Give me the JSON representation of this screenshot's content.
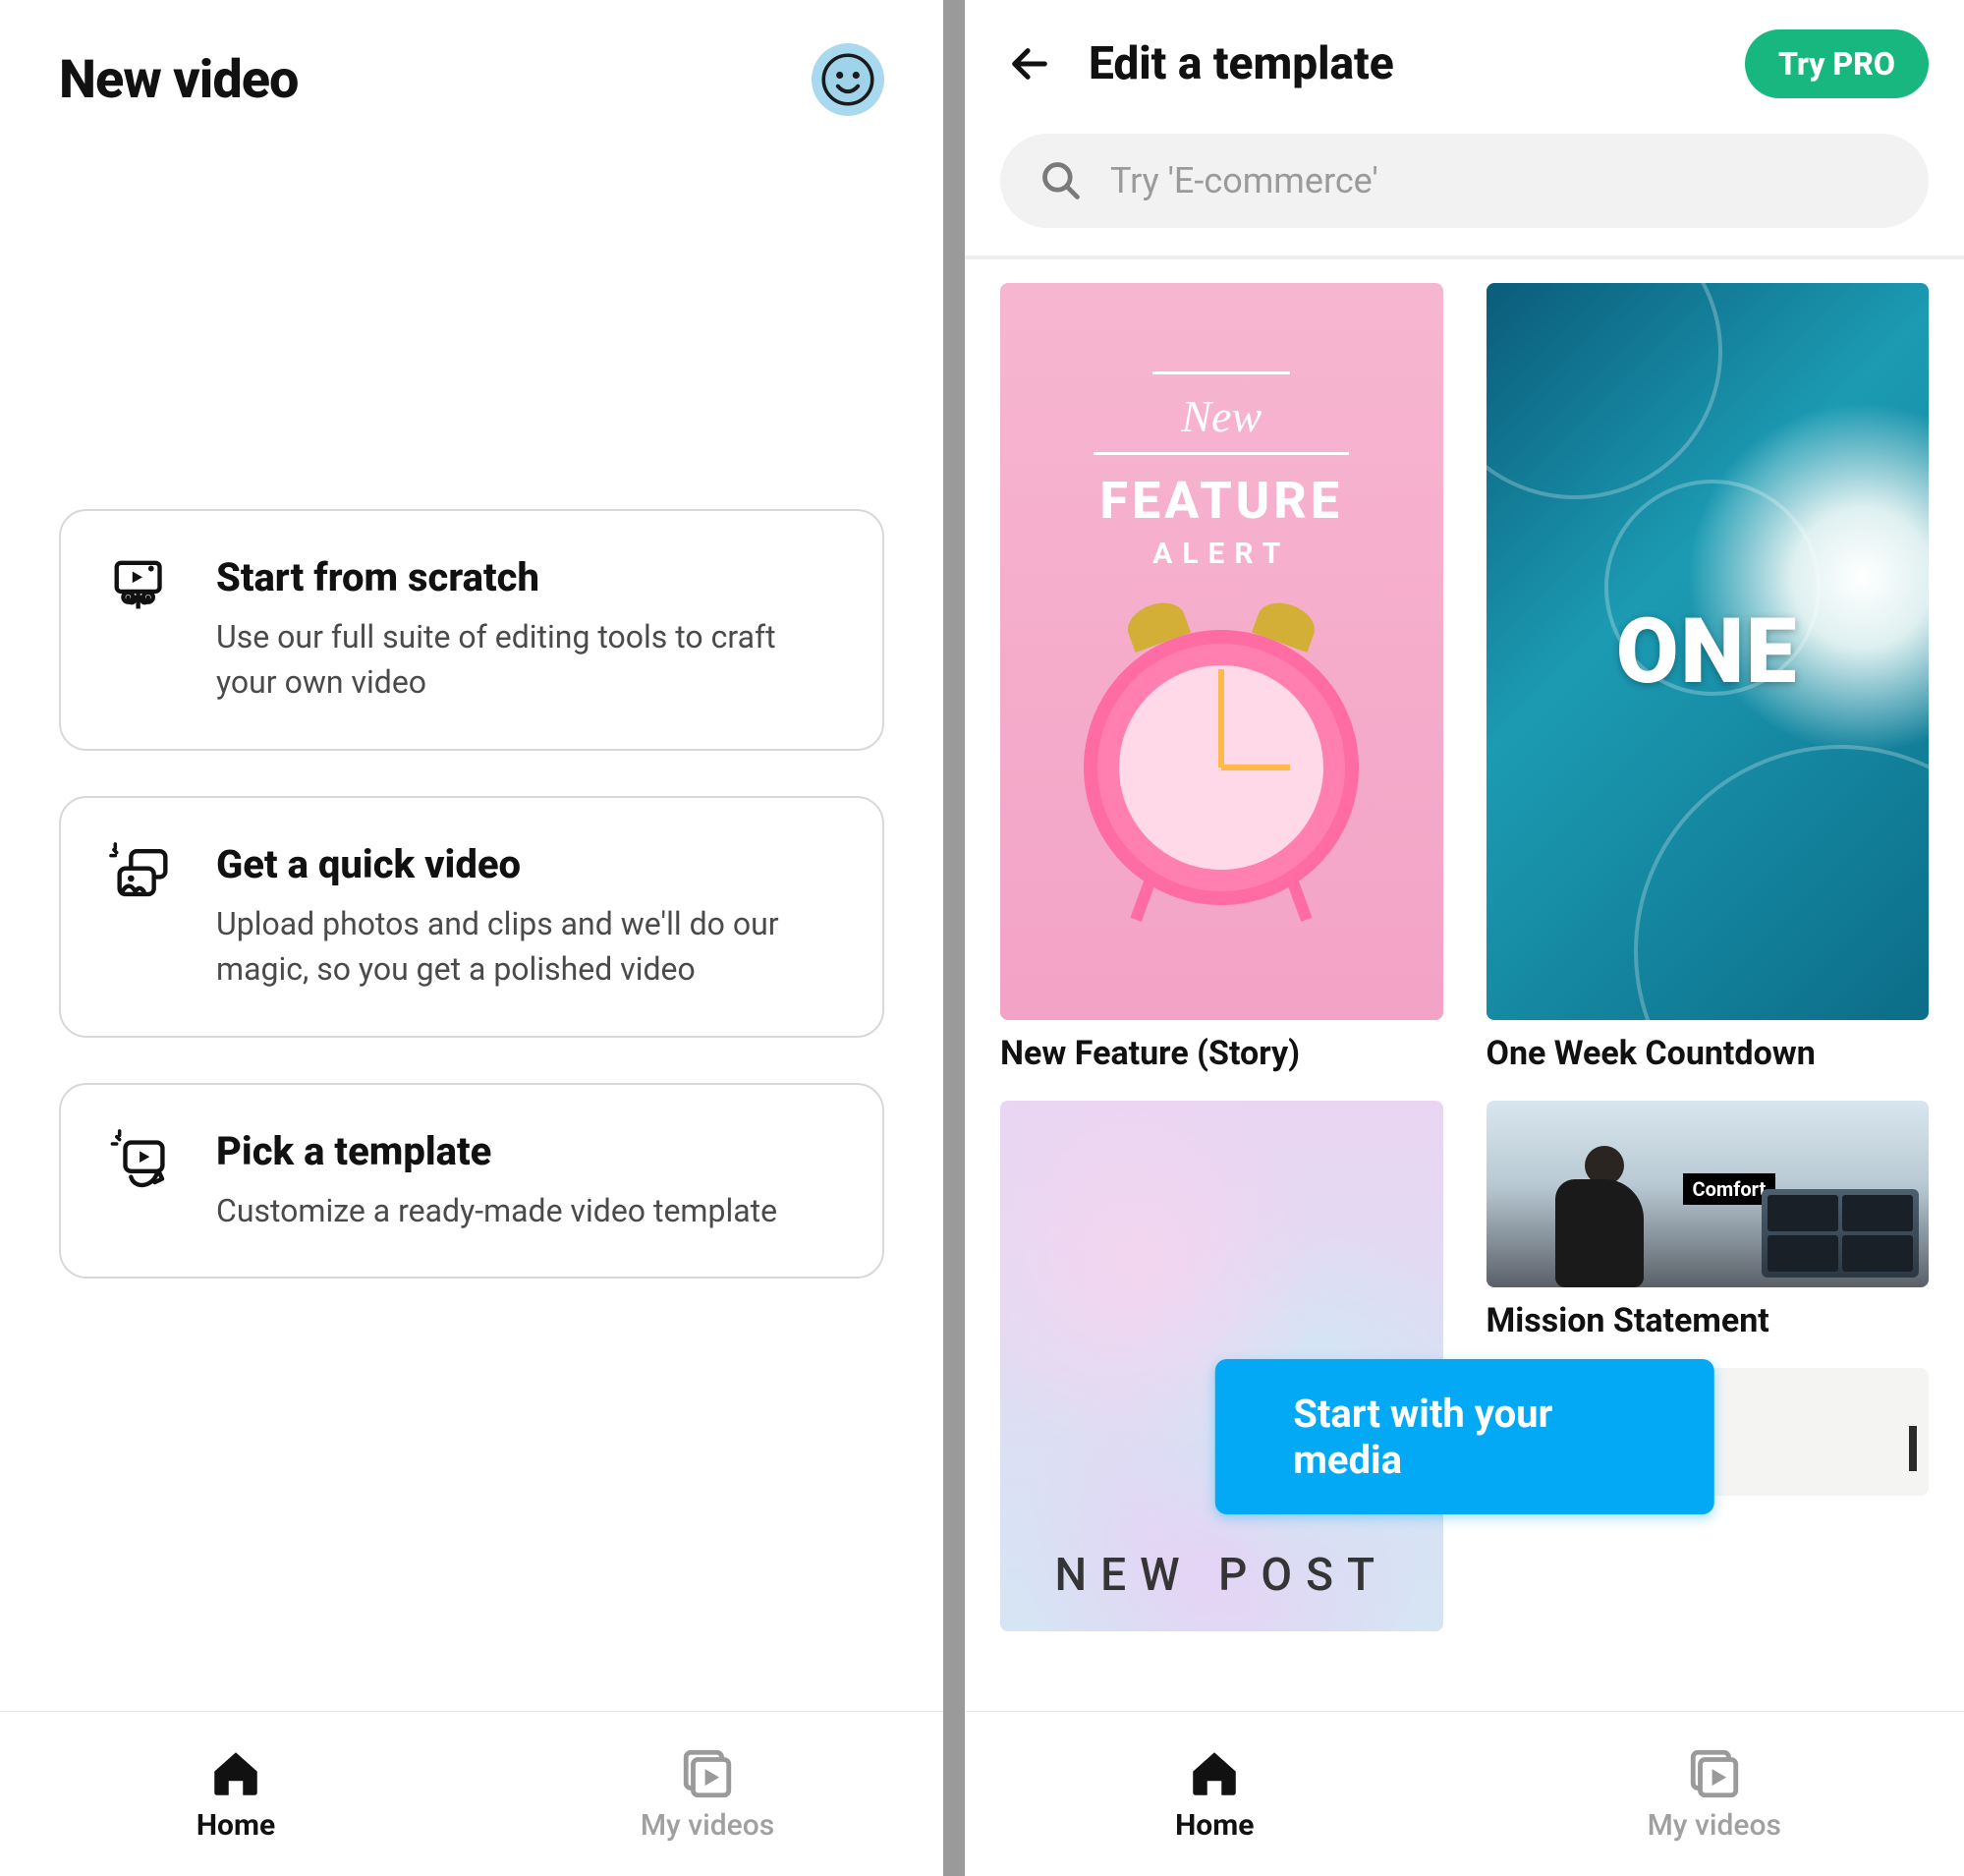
{
  "left": {
    "title": "New video",
    "cards": [
      {
        "title": "Start from scratch",
        "sub": "Use our full suite of editing tools to craft your own video"
      },
      {
        "title": "Get a quick video",
        "sub": "Upload photos and clips and we'll do our magic, so you get a polished video"
      },
      {
        "title": "Pick a template",
        "sub": "Customize a ready-made video template"
      }
    ]
  },
  "right": {
    "title": "Edit a template",
    "pro_label": "Try PRO",
    "search_placeholder": "Try 'E-commerce'",
    "templates": {
      "t1": {
        "label": "New Feature (Story)",
        "overlay_new": "New",
        "overlay_feature": "FEATURE",
        "overlay_alert": "ALERT"
      },
      "t2": {
        "label": "One Week Countdown",
        "overlay": "ONE"
      },
      "t3": {
        "label_hidden": "",
        "overlay": "NEW POST"
      },
      "t4": {
        "label": "Mission Statement",
        "badge": "Comfort"
      },
      "t5": {
        "label_hidden": ""
      }
    },
    "cta": "Start with your media"
  },
  "tabs": {
    "home": "Home",
    "videos": "My videos"
  }
}
